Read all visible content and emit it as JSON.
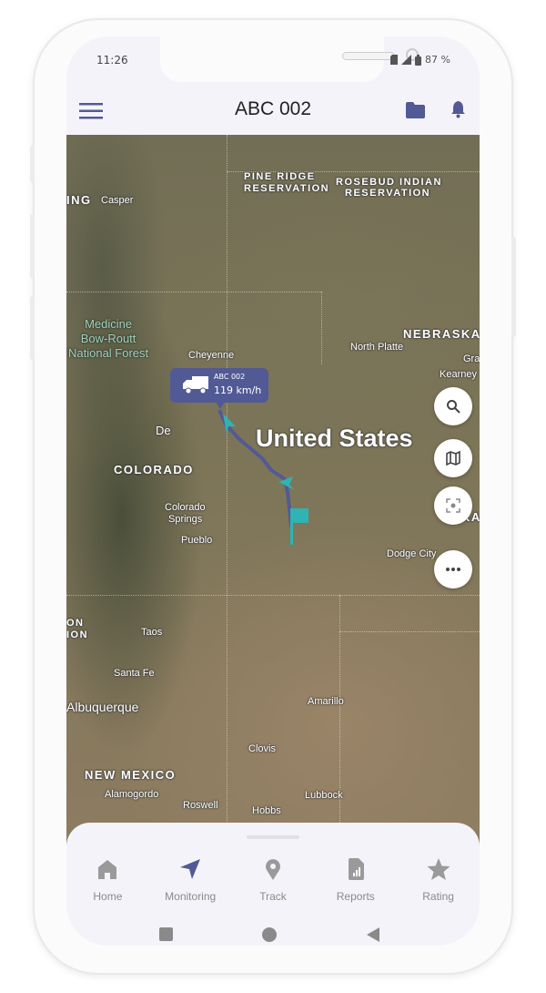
{
  "status_bar": {
    "time": "11:26",
    "battery": "87 %"
  },
  "header": {
    "title": "ABC 002"
  },
  "map": {
    "labels": {
      "wyoming_partial": "ING",
      "casper": "Casper",
      "pine_ridge": "PINE RIDGE",
      "pine_ridge_2": "RESERVATION",
      "rosebud": "ROSEBUD INDIAN",
      "rosebud_2": "RESERVATION",
      "medicine_bow": "Medicine",
      "medicine_bow_2": "Bow-Routt",
      "medicine_bow_3": "National Forest",
      "cheyenne": "Cheyenne",
      "nebraska": "NEBRASKA",
      "north_platte": "North Platte",
      "grand_partial": "Gra",
      "kearney": "Kearney",
      "denver_partial": "De",
      "united_states": "United States",
      "colorado": "COLORADO",
      "colorado_springs": "Colorado",
      "colorado_springs_2": "Springs",
      "pueblo": "Pueblo",
      "kansas_partial": "KA",
      "dodge_city": "Dodge City",
      "on_partial": "ON",
      "ion_partial": "ION",
      "taos": "Taos",
      "santa_fe": "Santa Fe",
      "albuquerque": "Albuquerque",
      "amarillo": "Amarillo",
      "clovis": "Clovis",
      "new_mexico": "NEW MEXICO",
      "roswell": "Roswell",
      "lubbock": "Lubbock",
      "alamogordo": "Alamogordo",
      "hobbs": "Hobbs"
    },
    "vehicle": {
      "name": "ABC 002",
      "speed": "119 km/h",
      "icon": "truck-icon"
    },
    "route_color": "#515a95",
    "marker_color": "#2fb3b3",
    "fabs": [
      "search-icon",
      "map-icon",
      "focus-icon",
      "more-icon"
    ]
  },
  "bottom_nav": {
    "items": [
      {
        "label": "Home",
        "icon": "home-icon",
        "active": false
      },
      {
        "label": "Monitoring",
        "icon": "navigation-icon",
        "active": true
      },
      {
        "label": "Track",
        "icon": "location-pin-icon",
        "active": false
      },
      {
        "label": "Reports",
        "icon": "report-icon",
        "active": false
      },
      {
        "label": "Rating",
        "icon": "star-icon",
        "active": false
      }
    ]
  },
  "colors": {
    "accent": "#515a95",
    "inactive": "#9a9a9a",
    "background": "#f5f3fa"
  }
}
